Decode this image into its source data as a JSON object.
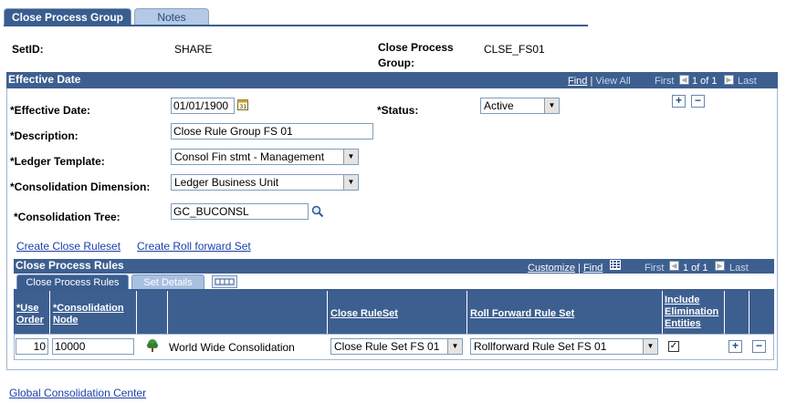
{
  "tabs": [
    {
      "label": "Close Process Group",
      "active": true
    },
    {
      "label": "Notes",
      "active": false
    }
  ],
  "header": {
    "setid_label": "SetID:",
    "setid_value": "SHARE",
    "group_label_line1": "Close Process",
    "group_label_line2": "Group:",
    "group_value": "CLSE_FS01"
  },
  "effective_date_box": {
    "title": "Effective Date",
    "find": "Find",
    "sep": "|",
    "view_all": "View All",
    "first": "First",
    "range": "1 of 1",
    "last": "Last"
  },
  "form": {
    "eff_date_label": "*Effective Date:",
    "eff_date_value": "01/01/1900",
    "status_label": "*Status:",
    "status_value": "Active",
    "description_label": "*Description:",
    "description_value": "Close Rule Group FS 01",
    "ledger_template_label": "*Ledger Template:",
    "ledger_template_value": "Consol Fin stmt - Management",
    "consol_dim_label": "*Consolidation Dimension:",
    "consol_dim_value": "Ledger Business Unit",
    "consol_tree_label": "*Consolidation Tree:",
    "consol_tree_value": "GC_BUCONSL"
  },
  "links": {
    "create_close_ruleset": "Create Close Ruleset",
    "create_roll_forward_set": "Create Roll forward Set",
    "global_consolidation_center": "Global Consolidation Center"
  },
  "grid": {
    "title": "Close Process Rules",
    "customize": "Customize",
    "find": "Find",
    "sep": "|",
    "first": "First",
    "range": "1 of 1",
    "last": "Last",
    "tabs": [
      {
        "label": "Close Process Rules",
        "active": true
      },
      {
        "label": "Set Details",
        "active": false
      }
    ],
    "columns": {
      "use_order_1": "*Use",
      "use_order_2": "Order",
      "consol_node_1": "*Consolidation",
      "consol_node_2": "Node",
      "close_ruleset": "Close RuleSet",
      "roll_forward": "Roll Forward Rule Set",
      "include_1": "Include",
      "include_2": "Elimination",
      "include_3": "Entities"
    },
    "row": {
      "use_order": "10",
      "consol_node": "10000",
      "node_description": "World Wide Consolidation",
      "close_ruleset": "Close Rule Set FS 01",
      "roll_forward": "Rollforward Rule Set FS 01",
      "include_elim": true,
      "check_mark": "✓"
    }
  },
  "icons": {
    "calendar": "calendar-icon",
    "lookup": "magnifier-icon",
    "tree": "tree-icon",
    "grid_view": "grid-view-icon"
  }
}
